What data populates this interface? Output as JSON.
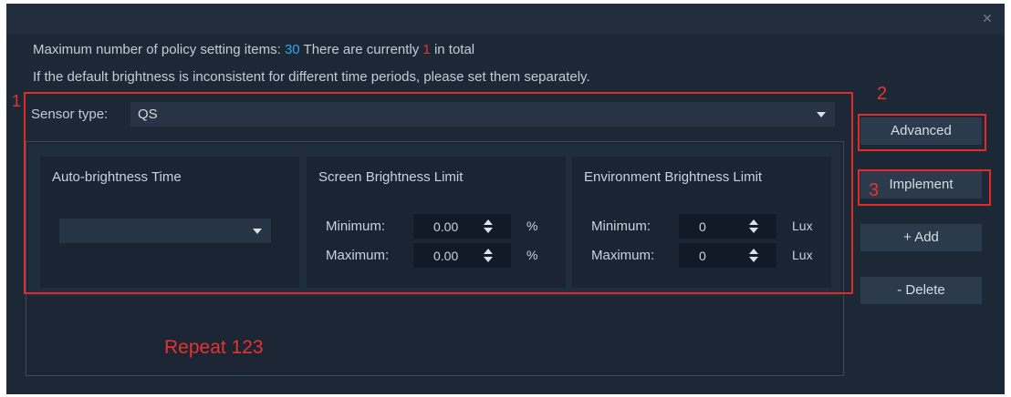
{
  "dialog": {
    "close_icon": "close-icon",
    "info_line1": {
      "prefix": "Maximum number of policy setting items:",
      "max": "30",
      "middle": "There are currently",
      "count": "1",
      "suffix": "in total"
    },
    "info_line2": "If the default brightness is inconsistent for different time periods, please set them separately."
  },
  "sensor": {
    "label": "Sensor type:",
    "value": "QS"
  },
  "cards": {
    "time": {
      "title": "Auto-brightness Time",
      "select_value": ""
    },
    "screen": {
      "title": "Screen Brightness Limit",
      "min_label": "Minimum:",
      "min_value": "0.00",
      "max_label": "Maximum:",
      "max_value": "0.00",
      "unit": "%"
    },
    "environment": {
      "title": "Environment Brightness Limit",
      "min_label": "Minimum:",
      "min_value": "0",
      "max_label": "Maximum:",
      "max_value": "0",
      "unit": "Lux"
    }
  },
  "buttons": {
    "advanced": "Advanced",
    "implement": "Implement",
    "add": "+ Add",
    "delete": "- Delete"
  },
  "annotations": {
    "n1": "1",
    "n2": "2",
    "n3": "3",
    "repeat": "Repeat 123",
    "color": "#e22a27"
  },
  "colors": {
    "accent_blue": "#2fa7e8",
    "accent_red": "#e8332f",
    "background": "#1d2836"
  }
}
